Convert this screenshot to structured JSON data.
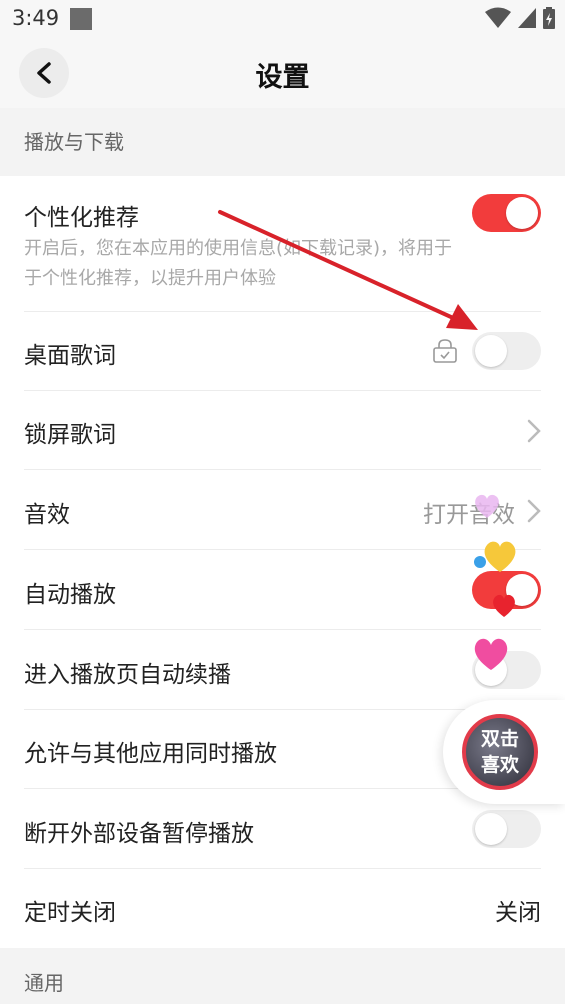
{
  "status_bar": {
    "time": "3:49"
  },
  "header": {
    "title": "设置"
  },
  "sections": {
    "play_download": "播放与下载",
    "general": "通用"
  },
  "settings": {
    "personalized": {
      "label": "个性化推荐",
      "description": "开启后，您在本应用的使用信息(如下载记录)，将用于于个性化推荐，以提升用户体验",
      "enabled": true
    },
    "desktop_lyrics": {
      "label": "桌面歌词",
      "enabled": false
    },
    "lockscreen_lyrics": {
      "label": "锁屏歌词"
    },
    "sound_effect": {
      "label": "音效",
      "value": "打开音效"
    },
    "autoplay": {
      "label": "自动播放",
      "enabled": true
    },
    "enter_play_page": {
      "label": "进入播放页自动续播",
      "enabled": false
    },
    "allow_simultaneous": {
      "label": "允许与其他应用同时播放"
    },
    "disconnect_pause": {
      "label": "断开外部设备暂停播放",
      "enabled": false
    },
    "sleep_timer": {
      "label": "定时关闭",
      "value": "关闭"
    }
  },
  "float_widget": {
    "line1": "双击",
    "line2": "喜欢"
  },
  "colors": {
    "accent": "#f23c3c",
    "toggle_off": "#eeeeee",
    "arrow": "#d8222a"
  }
}
